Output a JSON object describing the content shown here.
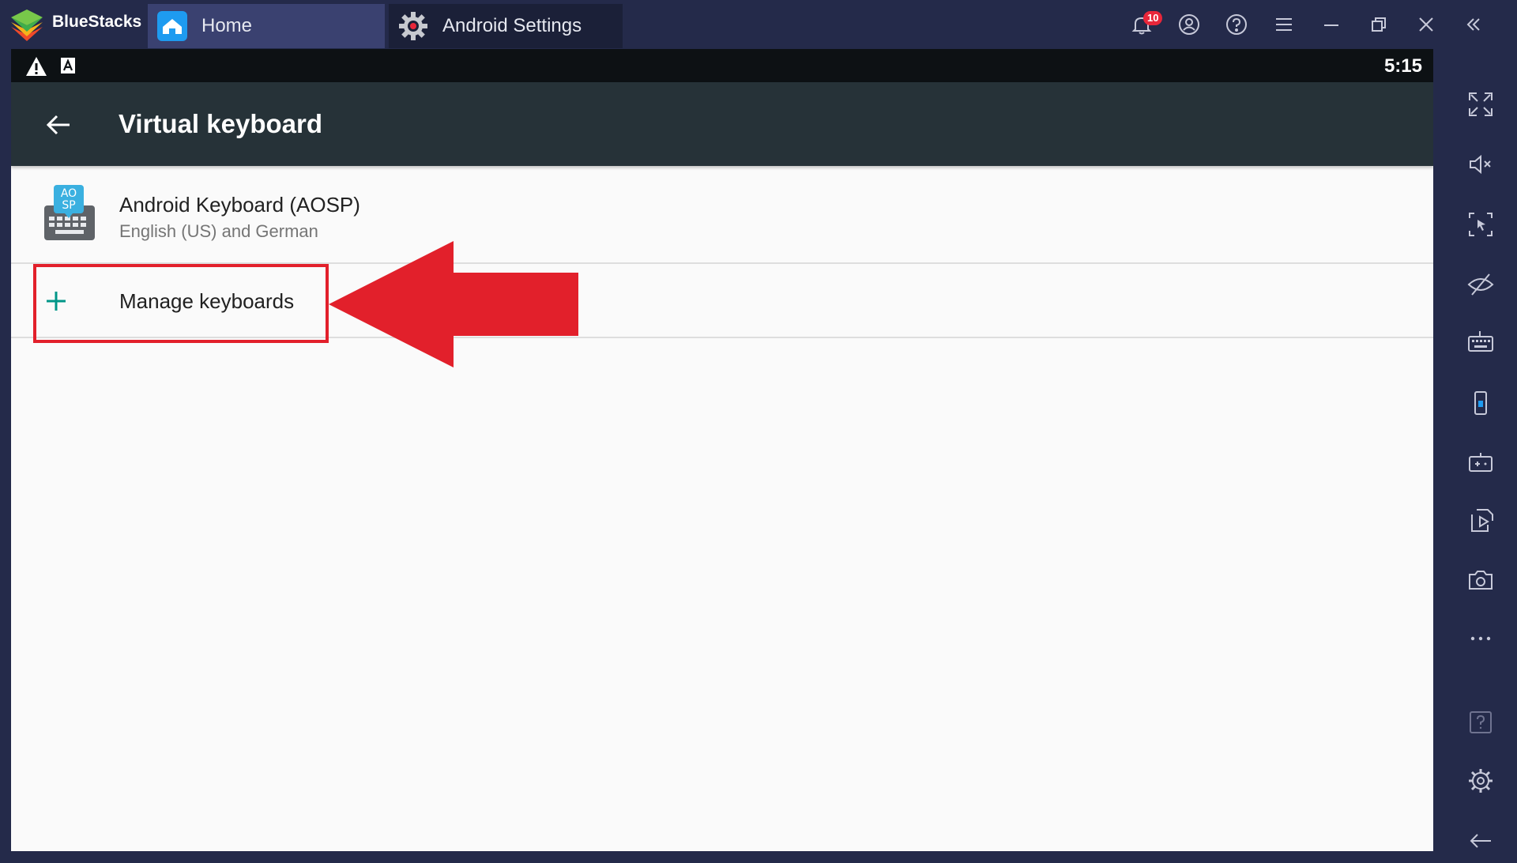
{
  "titlebar": {
    "app_name": "BlueStacks",
    "tabs": [
      {
        "label": "Home",
        "icon": "home-icon",
        "active": true
      },
      {
        "label": "Android Settings",
        "icon": "gear-icon",
        "active": false
      }
    ],
    "notification_count": "10",
    "accent_color": "#e8263a"
  },
  "statusbar": {
    "time": "5:15"
  },
  "appbar": {
    "title": "Virtual keyboard"
  },
  "keyboard_item": {
    "icon_text_line1": "AO",
    "icon_text_line2": "SP",
    "title": "Android Keyboard (AOSP)",
    "subtitle": "English (US) and German"
  },
  "manage_item": {
    "title": "Manage keyboards"
  },
  "annotation": {
    "color": "#e2202b"
  },
  "sidebar": {
    "buttons": [
      "fullscreen-icon",
      "volume-mute-icon",
      "pointer-lock-icon",
      "eye-off-icon",
      "keyboard-icon",
      "phone-rotate-icon",
      "gamepad-icon",
      "media-import-icon",
      "camera-icon",
      "more-icon",
      "help-icon",
      "settings-icon",
      "back-icon"
    ]
  }
}
